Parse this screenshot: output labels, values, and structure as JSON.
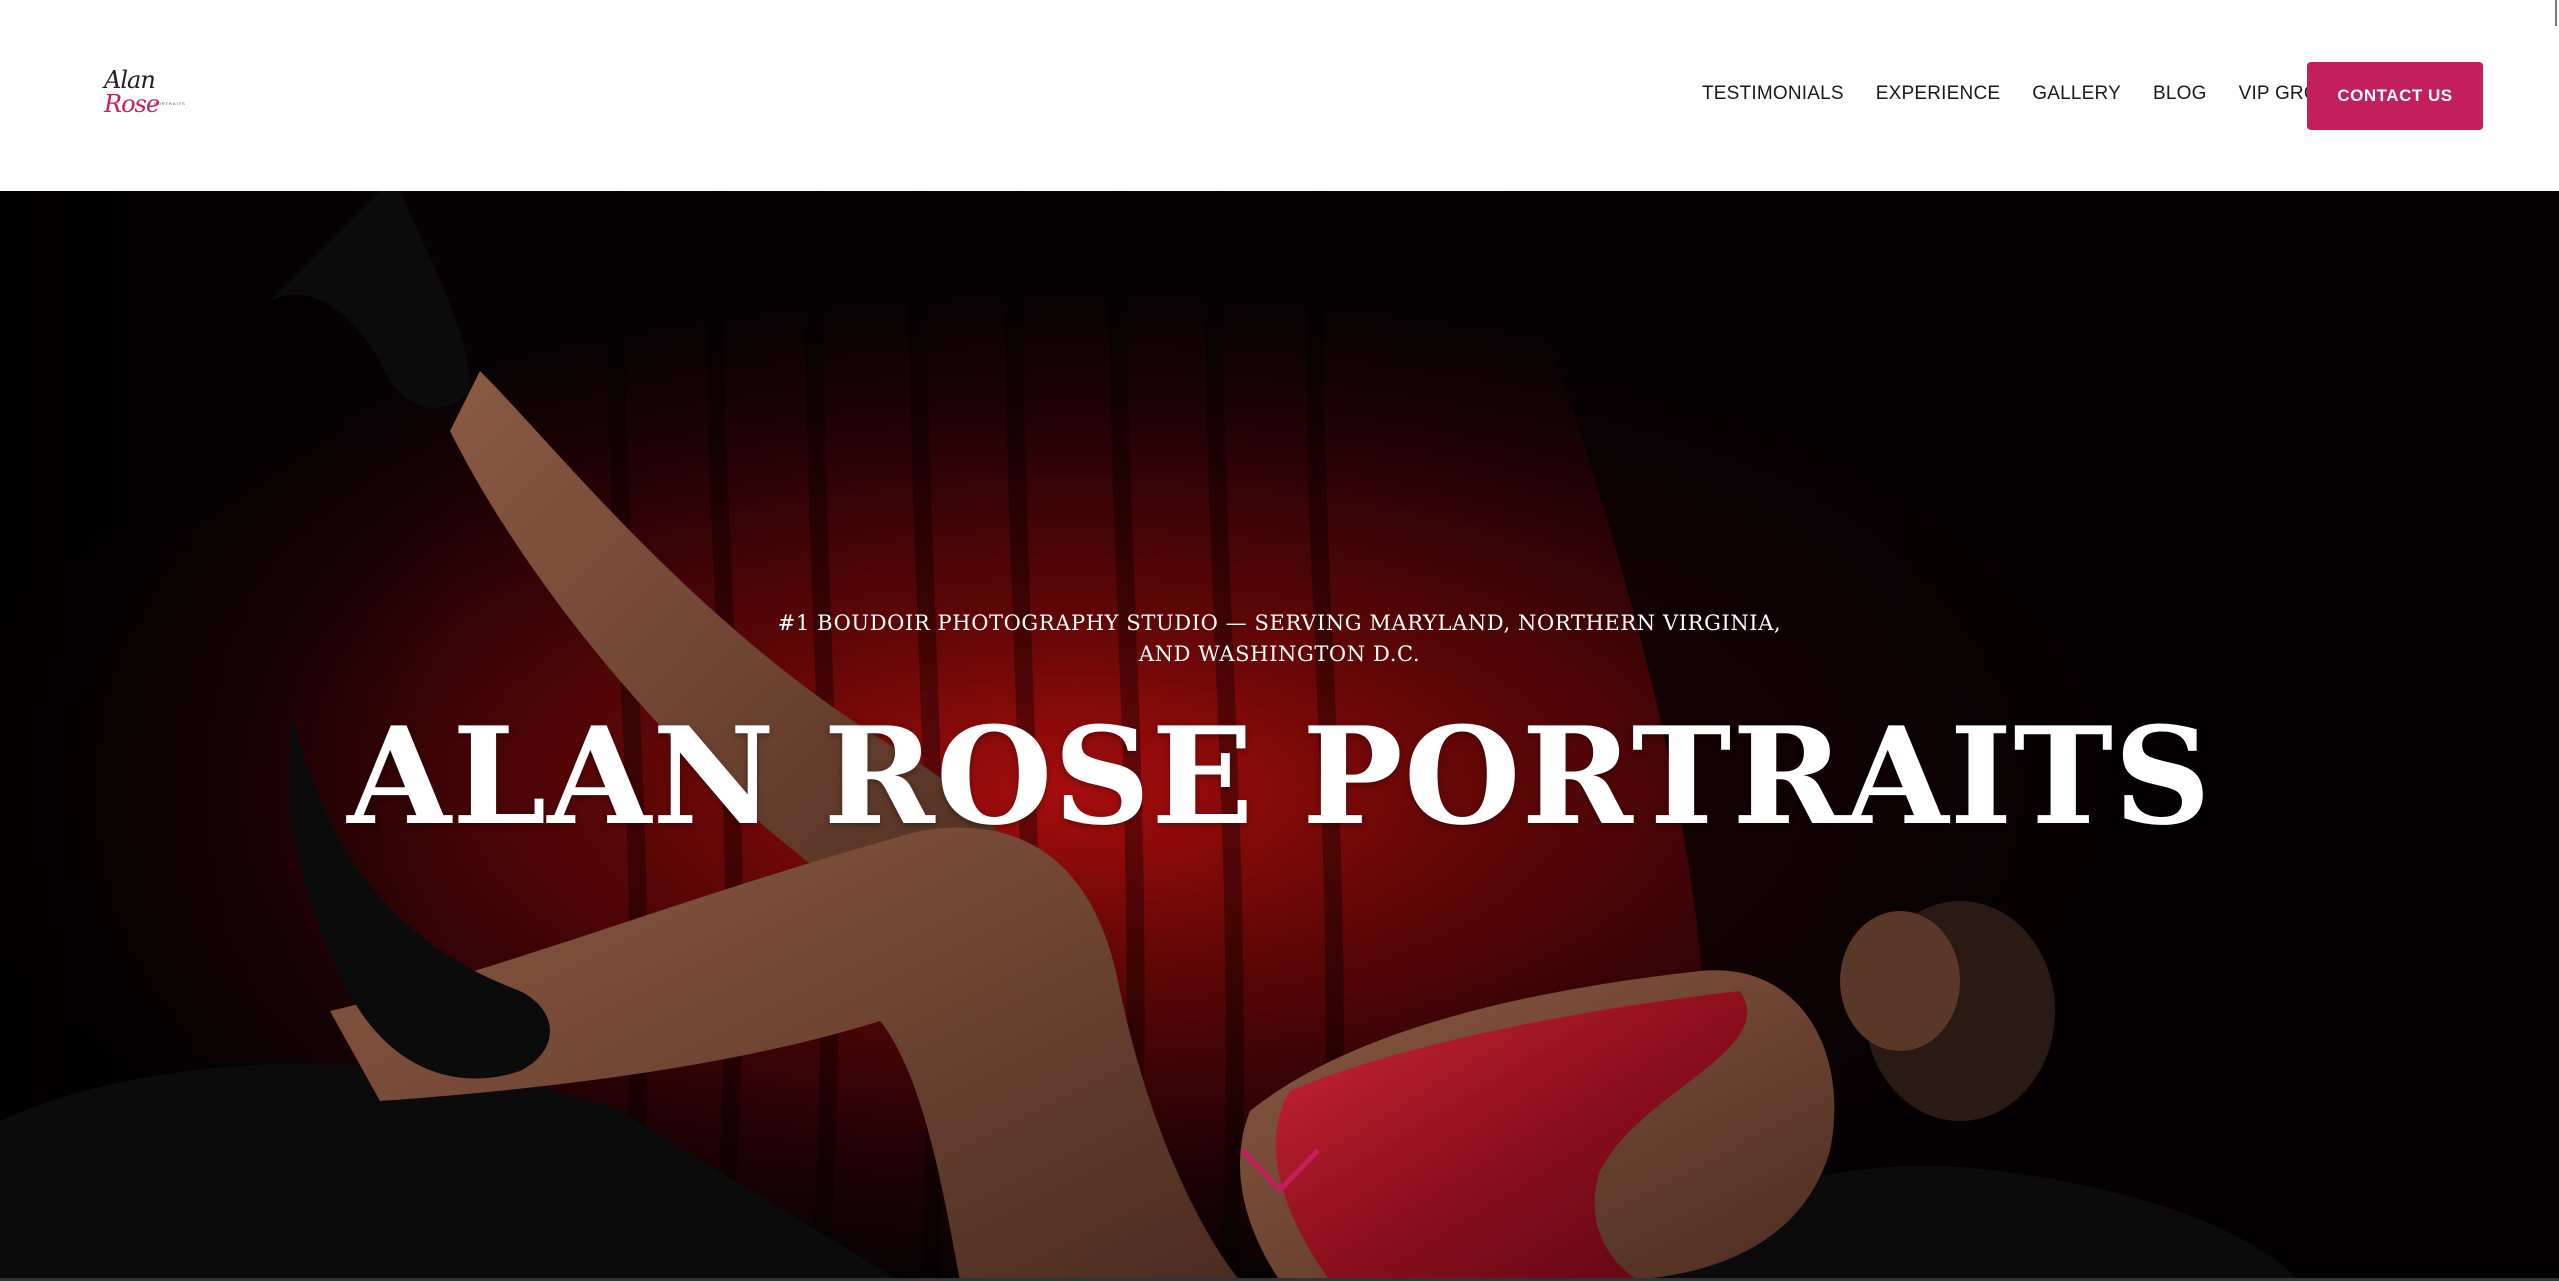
{
  "header": {
    "logo": {
      "script_main": "Alan ",
      "script_accent": "Rose",
      "sub": "PORTRAITS"
    },
    "nav": [
      {
        "label": "TESTIMONIALS"
      },
      {
        "label": "EXPERIENCE"
      },
      {
        "label": "GALLERY"
      },
      {
        "label": "BLOG"
      },
      {
        "label": "VIP GROUP"
      }
    ],
    "contact_button": "CONTACT US"
  },
  "hero": {
    "tagline_line1": "#1 BOUDOIR PHOTOGRAPHY STUDIO — SERVING MARYLAND, NORTHERN VIRGINIA,",
    "tagline_line2": "AND WASHINGTON D.C.",
    "title": "ALAN ROSE PORTRAITS",
    "scroll_icon": "chevron-down-icon"
  },
  "colors": {
    "accent": "#c21f5c",
    "header_bg": "#ffffff",
    "hero_text": "#ffffff",
    "nav_text": "#1a1a1a"
  }
}
